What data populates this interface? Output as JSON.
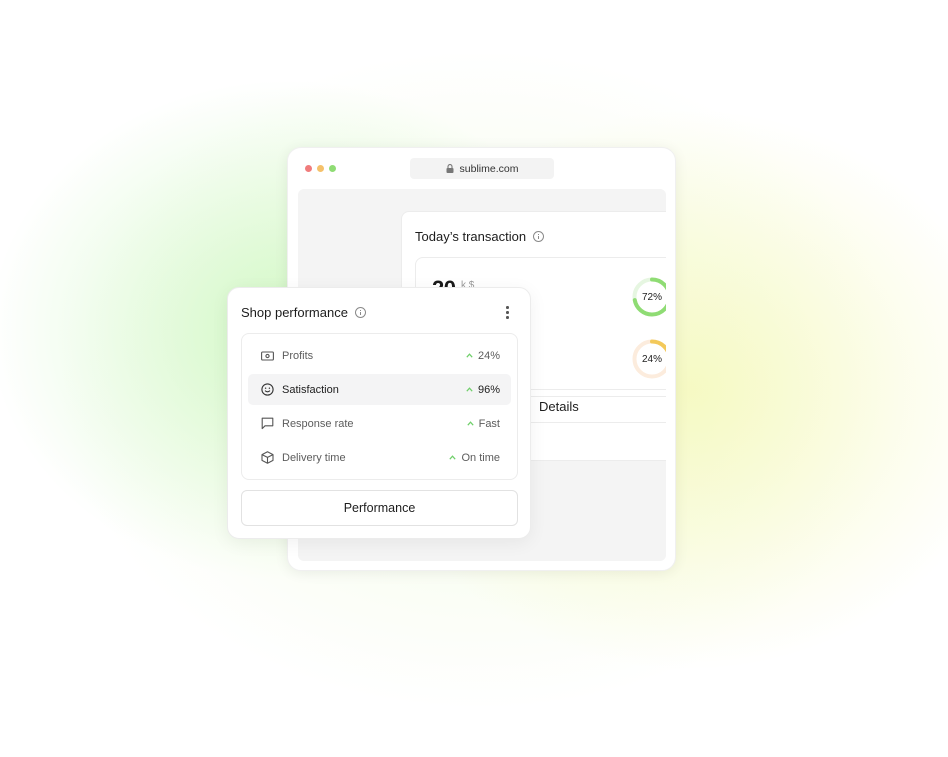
{
  "browser": {
    "url": "sublime.com"
  },
  "transaction": {
    "title": "Today’s transaction",
    "amount": "20",
    "unit": "k $",
    "donuts": [
      {
        "label": "72%",
        "value": 72,
        "color": "#8fdc74",
        "track": "#e6f6e1"
      },
      {
        "label": "24%",
        "value": 24,
        "color": "#f3c95a",
        "track": "#fcecdd"
      }
    ],
    "details_label": "Details"
  },
  "shop": {
    "title": "Shop performance",
    "metrics": [
      {
        "label": "Profits",
        "value": "24%",
        "icon": "cash-icon"
      },
      {
        "label": "Satisfaction",
        "value": "96%",
        "icon": "smile-icon"
      },
      {
        "label": "Response rate",
        "value": "Fast",
        "icon": "message-icon"
      },
      {
        "label": "Delivery time",
        "value": "On time",
        "icon": "box-icon"
      }
    ],
    "button_label": "Performance"
  },
  "colors": {
    "accent_green": "#6fcf6a",
    "accent_yellow": "#f3c95a"
  }
}
